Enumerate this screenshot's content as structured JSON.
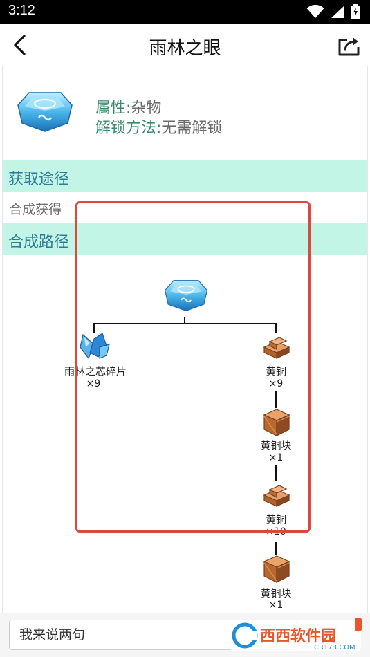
{
  "status_bar": {
    "time": "3:12"
  },
  "header": {
    "title": "雨林之眼"
  },
  "item": {
    "attr_label": "属性:",
    "attr_value": "杂物",
    "unlock_label": "解锁方法:",
    "unlock_value": "无需解锁"
  },
  "sections": {
    "obtain_title": "获取途径",
    "obtain_text": "合成获得",
    "recipe_title": "合成路径"
  },
  "recipe_tree": {
    "root": "雨林之眼",
    "nodes": [
      {
        "label": "雨林之芯碎片",
        "count": "×9"
      },
      {
        "label": "黄铜",
        "count": "×9"
      },
      {
        "label": "黄铜块",
        "count": "×1"
      },
      {
        "label": "黄铜",
        "count": "×10"
      },
      {
        "label": "黄铜块",
        "count": "×1"
      }
    ]
  },
  "comment": {
    "placeholder": "我来说两句"
  },
  "watermark": {
    "text": "西西软件园",
    "sub": "CR173.COM"
  },
  "colors": {
    "section_bg": "#c2f5e6",
    "section_text": "#2e7d98",
    "attr_key": "#3a8a6c",
    "highlight": "#d94a3a"
  }
}
